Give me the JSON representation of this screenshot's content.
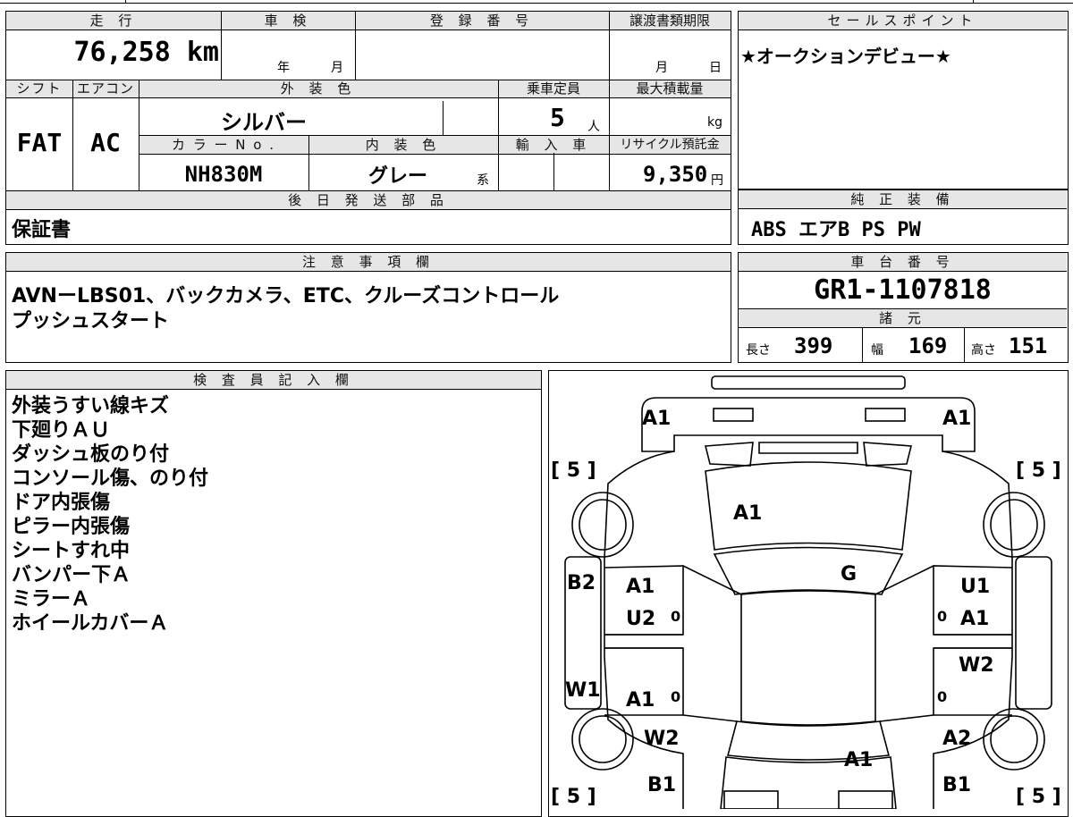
{
  "mileage": {
    "header": "走 行",
    "value": "76,258 km"
  },
  "inspection": {
    "header": "車 検",
    "year_unit": "年",
    "month_unit": "月"
  },
  "registration": {
    "header": "登 録 番 号",
    "value": ""
  },
  "transfer_deadline": {
    "header": "譲渡書類期限",
    "month_unit": "月",
    "day_unit": "日"
  },
  "sales_point": {
    "header": "セールスポイント",
    "text": "★オークションデビュー★"
  },
  "shift": {
    "header": "シフト",
    "value": "FAT"
  },
  "aircon": {
    "header": "エアコン",
    "value": "AC"
  },
  "exterior_color": {
    "header": "外 装 色",
    "value": "シルバー"
  },
  "capacity": {
    "header": "乗車定員",
    "value": "5",
    "unit": "人"
  },
  "max_load": {
    "header": "最大積載量",
    "unit": "kg"
  },
  "color_no": {
    "header": "カ ラ ー N o .",
    "value": "NH830M"
  },
  "interior_color": {
    "header": "内 装 色",
    "value": "グレー",
    "suffix": "系"
  },
  "import": {
    "header": "輸 入 車"
  },
  "recycle_fee": {
    "header": "リサイクル預託金",
    "value": "9,350",
    "unit": "円"
  },
  "later_parts": {
    "header": "後 日 発 送 部 品",
    "value": "保証書"
  },
  "genuine_equipment": {
    "header": "純 正 装 備",
    "value": "ABS エアB PS PW"
  },
  "notes": {
    "header": "注 意 事 項 欄",
    "line1": "AVNーLBS01、バックカメラ、ETC、クルーズコントロール",
    "line2": "プッシュスタート"
  },
  "chassis": {
    "header": "車 台 番 号",
    "value": "GR1-1107818"
  },
  "specs": {
    "header": "諸 元",
    "length_label": "長さ",
    "length": "399",
    "width_label": "幅",
    "width": "169",
    "height_label": "高さ",
    "height": "151"
  },
  "inspector": {
    "header": "検 査 員 記 入 欄",
    "lines": [
      "外装うすい線キズ",
      "下廻りＡＵ",
      "ダッシュ板のり付",
      "コンソール傷、のり付",
      "ドア内張傷",
      "ピラー内張傷",
      "シートすれ中",
      "バンパー下Ａ",
      "ミラーＡ",
      "ホイールカバーＡ"
    ]
  },
  "diagram": {
    "tire_tl": "[ 5 ]",
    "tire_tr": "[ 5 ]",
    "tire_bl": "[ 5 ]",
    "tire_br": "[ 5 ]",
    "front_left": "A1",
    "front_right": "A1",
    "hood": "A1",
    "windshield": "G",
    "left_fender": "B2",
    "front_door_left_1": "A1",
    "front_door_left_2": "U2",
    "front_door_left_3": "0",
    "front_door_right_1": "U1",
    "front_door_right_2": "A1",
    "front_door_right_3": "0",
    "left_side": "W1",
    "rear_door_left_1": "A1",
    "rear_door_left_2": "0",
    "rear_door_right_1": "W2",
    "rear_door_right_2": "0",
    "rear_left_1": "W2",
    "rear_left_2": "B1",
    "rear_right_1": "A2",
    "rear_right_2": "B1",
    "trunk": "A1"
  }
}
